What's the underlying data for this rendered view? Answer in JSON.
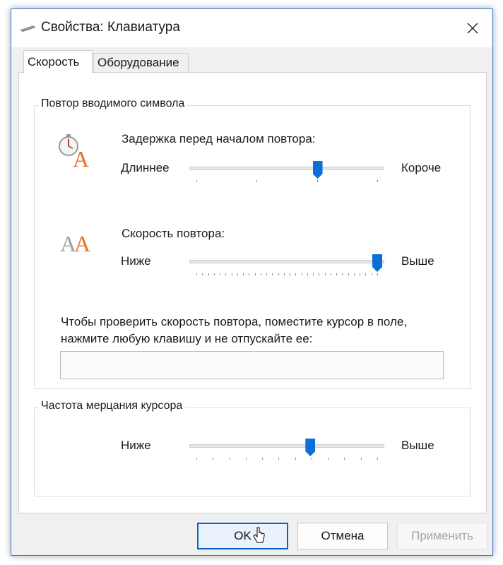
{
  "window": {
    "title": "Свойства: Клавиатура",
    "icon": "keyboard-icon",
    "accent_color": "#0a6fd6"
  },
  "tabs": [
    {
      "label": "Скорость",
      "active": true
    },
    {
      "label": "Оборудование",
      "active": false
    }
  ],
  "repeat_group": {
    "title": "Повтор вводимого символа",
    "delay": {
      "icon": "stopwatch-letter-icon",
      "label": "Задержка перед началом повтора:",
      "min_label": "Длиннее",
      "max_label": "Короче",
      "value_fraction": 0.67,
      "tick_count": 4
    },
    "rate": {
      "icon": "double-letter-icon",
      "label": "Скорость повтора:",
      "min_label": "Ниже",
      "max_label": "Выше",
      "value_fraction": 1.0,
      "tick_count": 32
    },
    "test_instruction_line1": "Чтобы проверить скорость повтора, поместите курсор в поле,",
    "test_instruction_line2": "нажмите любую клавишу и не отпускайте ее:",
    "test_input_value": ""
  },
  "blink_group": {
    "title": "Частота мерцания курсора",
    "min_label": "Ниже",
    "max_label": "Выше",
    "value_fraction": 0.63,
    "tick_count": 12
  },
  "buttons": {
    "ok": "OK",
    "cancel": "Отмена",
    "apply": "Применить"
  }
}
